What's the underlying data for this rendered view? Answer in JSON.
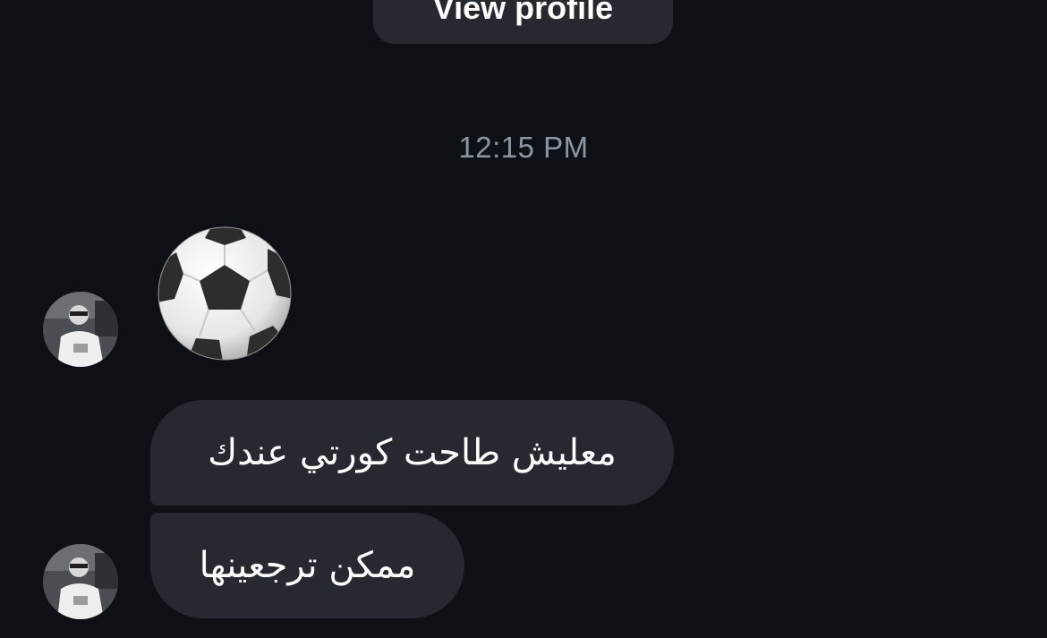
{
  "header": {
    "view_profile_label": "View profile"
  },
  "chat": {
    "timestamp": "12:15 PM",
    "messages": [
      {
        "type": "emoji",
        "emoji_name": "soccer-ball-icon"
      },
      {
        "type": "text",
        "text": "معليش طاحت كورتي عندك"
      },
      {
        "type": "text",
        "text": "ممكن ترجعينها"
      }
    ]
  },
  "colors": {
    "background": "#0d1116",
    "bubble": "#262a30",
    "timestamp": "#8b96a1",
    "text": "#ffffff"
  }
}
